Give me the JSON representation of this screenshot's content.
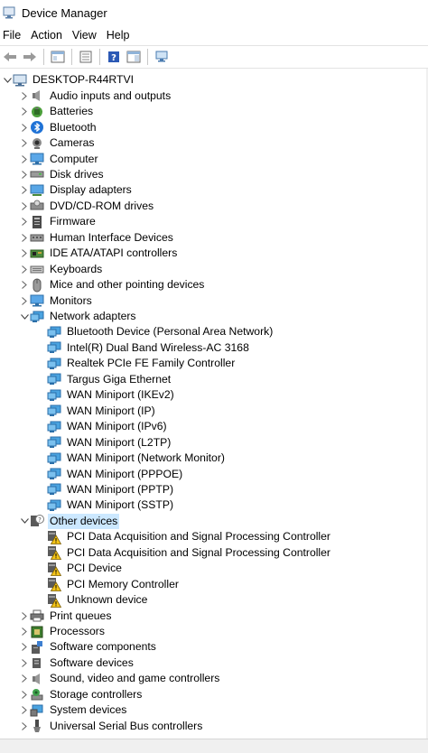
{
  "window": {
    "title": "Device Manager"
  },
  "menu": [
    "File",
    "Action",
    "View",
    "Help"
  ],
  "toolbar": [
    "back-icon",
    "forward-icon",
    "console-tree-icon",
    "properties-icon",
    "help-icon",
    "action-pane-icon",
    "scan-hardware-icon"
  ],
  "tree": {
    "root": "DESKTOP-R44RTVI",
    "items": [
      {
        "label": "Audio inputs and outputs",
        "icon": "speaker-icon",
        "level": 1,
        "expander": "collapsed"
      },
      {
        "label": "Batteries",
        "icon": "battery-icon",
        "level": 1,
        "expander": "collapsed"
      },
      {
        "label": "Bluetooth",
        "icon": "bluetooth-icon",
        "level": 1,
        "expander": "collapsed"
      },
      {
        "label": "Cameras",
        "icon": "camera-icon",
        "level": 1,
        "expander": "collapsed"
      },
      {
        "label": "Computer",
        "icon": "computer-icon",
        "level": 1,
        "expander": "collapsed"
      },
      {
        "label": "Disk drives",
        "icon": "disk-drive-icon",
        "level": 1,
        "expander": "collapsed"
      },
      {
        "label": "Display adapters",
        "icon": "display-adapter-icon",
        "level": 1,
        "expander": "collapsed"
      },
      {
        "label": "DVD/CD-ROM drives",
        "icon": "dvd-icon",
        "level": 1,
        "expander": "collapsed"
      },
      {
        "label": "Firmware",
        "icon": "firmware-icon",
        "level": 1,
        "expander": "collapsed"
      },
      {
        "label": "Human Interface Devices",
        "icon": "hid-icon",
        "level": 1,
        "expander": "collapsed"
      },
      {
        "label": "IDE ATA/ATAPI controllers",
        "icon": "ide-controller-icon",
        "level": 1,
        "expander": "collapsed"
      },
      {
        "label": "Keyboards",
        "icon": "keyboard-icon",
        "level": 1,
        "expander": "collapsed"
      },
      {
        "label": "Mice and other pointing devices",
        "icon": "mouse-icon",
        "level": 1,
        "expander": "collapsed"
      },
      {
        "label": "Monitors",
        "icon": "monitor-icon",
        "level": 1,
        "expander": "collapsed"
      },
      {
        "label": "Network adapters",
        "icon": "network-adapter-icon",
        "level": 1,
        "expander": "expanded"
      },
      {
        "label": "Bluetooth Device (Personal Area Network)",
        "icon": "network-adapter-icon",
        "level": 2
      },
      {
        "label": "Intel(R) Dual Band Wireless-AC 3168",
        "icon": "network-adapter-icon",
        "level": 2
      },
      {
        "label": "Realtek PCIe FE Family Controller",
        "icon": "network-adapter-icon",
        "level": 2
      },
      {
        "label": "Targus Giga Ethernet",
        "icon": "network-adapter-icon",
        "level": 2
      },
      {
        "label": "WAN Miniport (IKEv2)",
        "icon": "network-adapter-icon",
        "level": 2
      },
      {
        "label": "WAN Miniport (IP)",
        "icon": "network-adapter-icon",
        "level": 2
      },
      {
        "label": "WAN Miniport (IPv6)",
        "icon": "network-adapter-icon",
        "level": 2
      },
      {
        "label": "WAN Miniport (L2TP)",
        "icon": "network-adapter-icon",
        "level": 2
      },
      {
        "label": "WAN Miniport (Network Monitor)",
        "icon": "network-adapter-icon",
        "level": 2
      },
      {
        "label": "WAN Miniport (PPPOE)",
        "icon": "network-adapter-icon",
        "level": 2
      },
      {
        "label": "WAN Miniport (PPTP)",
        "icon": "network-adapter-icon",
        "level": 2
      },
      {
        "label": "WAN Miniport (SSTP)",
        "icon": "network-adapter-icon",
        "level": 2
      },
      {
        "label": "Other devices",
        "icon": "unknown-device-icon",
        "level": 1,
        "expander": "expanded",
        "selected": true
      },
      {
        "label": "PCI Data Acquisition and Signal Processing Controller",
        "icon": "warning-device-icon",
        "level": 2
      },
      {
        "label": "PCI Data Acquisition and Signal Processing Controller",
        "icon": "warning-device-icon",
        "level": 2
      },
      {
        "label": "PCI Device",
        "icon": "warning-device-icon",
        "level": 2
      },
      {
        "label": "PCI Memory Controller",
        "icon": "warning-device-icon",
        "level": 2
      },
      {
        "label": "Unknown device",
        "icon": "warning-device-icon",
        "level": 2
      },
      {
        "label": "Print queues",
        "icon": "printer-icon",
        "level": 1,
        "expander": "collapsed"
      },
      {
        "label": "Processors",
        "icon": "processor-icon",
        "level": 1,
        "expander": "collapsed"
      },
      {
        "label": "Software components",
        "icon": "software-component-icon",
        "level": 1,
        "expander": "collapsed"
      },
      {
        "label": "Software devices",
        "icon": "software-device-icon",
        "level": 1,
        "expander": "collapsed"
      },
      {
        "label": "Sound, video and game controllers",
        "icon": "sound-icon",
        "level": 1,
        "expander": "collapsed"
      },
      {
        "label": "Storage controllers",
        "icon": "storage-controller-icon",
        "level": 1,
        "expander": "collapsed"
      },
      {
        "label": "System devices",
        "icon": "system-device-icon",
        "level": 1,
        "expander": "collapsed"
      },
      {
        "label": "Universal Serial Bus controllers",
        "icon": "usb-icon",
        "level": 1,
        "expander": "collapsed"
      }
    ]
  },
  "colors": {
    "selection": "#cce8ff",
    "accent": "#0078d7",
    "warning": "#f5c518"
  }
}
